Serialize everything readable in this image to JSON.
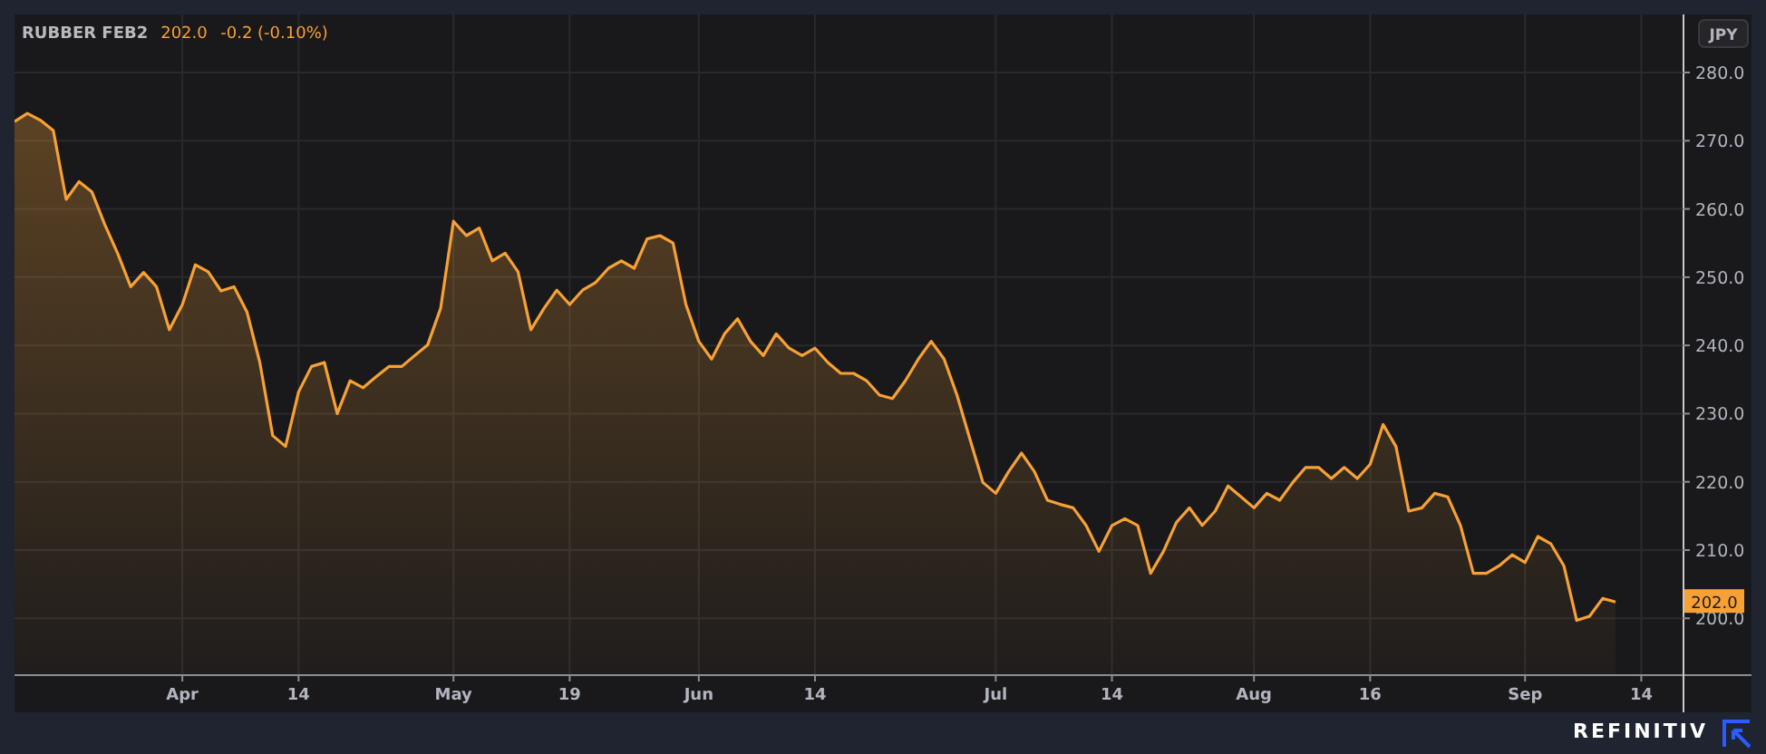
{
  "header": {
    "price": "202.0",
    "change": "-0.2 (-0.10%)"
  },
  "currency": "JPY",
  "last_price_label": "202.0",
  "chart_data": {
    "type": "area",
    "grid": true,
    "ylim": [
      191.8,
      288.5
    ],
    "categories": [
      null,
      null,
      null,
      null,
      null,
      null,
      null,
      null,
      null,
      null,
      null,
      null,
      null,
      "Apr",
      null,
      null,
      null,
      null,
      null,
      null,
      null,
      null,
      "14",
      null,
      null,
      null,
      null,
      null,
      null,
      null,
      null,
      null,
      null,
      null,
      "May",
      null,
      null,
      null,
      null,
      null,
      null,
      null,
      null,
      "19",
      null,
      null,
      null,
      null,
      null,
      null,
      null,
      null,
      null,
      "Jun",
      null,
      null,
      null,
      null,
      null,
      null,
      null,
      null,
      "14",
      null,
      null,
      null,
      null,
      null,
      null,
      null,
      null,
      null,
      null,
      null,
      null,
      null,
      "Jul",
      null,
      null,
      null,
      null,
      null,
      null,
      null,
      null,
      "14",
      null,
      null,
      null,
      null,
      null,
      null,
      null,
      null,
      null,
      null,
      "Aug",
      null,
      null,
      null,
      null,
      null,
      null,
      null,
      null,
      "16",
      null,
      null,
      null,
      null,
      null,
      null,
      null,
      null,
      null,
      null,
      null,
      "Sep",
      null,
      null,
      null,
      null,
      null,
      null,
      null,
      null,
      "14",
      null,
      null,
      null
    ],
    "series": [
      {
        "name": "RUBBER FEB2",
        "color": "#f7a135",
        "values": [
          272.8,
          274,
          273,
          271.5,
          261.4,
          264,
          262.5,
          257.7,
          253.4,
          248.6,
          250.7,
          248.6,
          242.3,
          246,
          251.8,
          250.8,
          248,
          248.6,
          244.9,
          237.5,
          226.8,
          225.2,
          233.2,
          236.9,
          237.5,
          230,
          234.8,
          233.8,
          235.4,
          236.9,
          236.9,
          238.5,
          240.1,
          245.4,
          258.2,
          256.1,
          257.2,
          252.4,
          253.5,
          250.8,
          242.3,
          245.4,
          248.1,
          246,
          248.1,
          249.2,
          251.3,
          252.4,
          251.3,
          255.6,
          256.1,
          255,
          246,
          240.6,
          238,
          241.7,
          243.9,
          240.6,
          238.5,
          241.7,
          239.6,
          238.5,
          239.6,
          237.5,
          235.9,
          235.9,
          234.8,
          232.7,
          232.2,
          234.8,
          238,
          240.6,
          238,
          232.7,
          226.3,
          219.9,
          218.3,
          221.5,
          224.2,
          221.5,
          217.3,
          216.7,
          216.2,
          213.6,
          209.8,
          213.6,
          214.6,
          213.6,
          206.6,
          209.8,
          214.1,
          216.2,
          213.6,
          215.7,
          219.4,
          217.8,
          216.2,
          218.3,
          217.3,
          219.9,
          222.1,
          222.1,
          220.5,
          222.1,
          220.5,
          222.6,
          228.4,
          225.2,
          215.7,
          216.2,
          218.3,
          217.8,
          213.6,
          206.6,
          206.6,
          207.7,
          209.3,
          208.2,
          212,
          210.9,
          207.7,
          199.7,
          200.3,
          202.9,
          202.4,
          null,
          null,
          null,
          null,
          null
        ]
      }
    ],
    "yticks": [
      {
        "value": 200,
        "label": "200.0"
      },
      {
        "value": 210,
        "label": "210.0"
      },
      {
        "value": 220,
        "label": "220.0"
      },
      {
        "value": 230,
        "label": "230.0"
      },
      {
        "value": 240,
        "label": "240.0"
      },
      {
        "value": 250,
        "label": "250.0"
      },
      {
        "value": 260,
        "label": "260.0"
      },
      {
        "value": 270,
        "label": "270.0"
      },
      {
        "value": 280,
        "label": "280.0"
      }
    ]
  },
  "brand": "REFINITIV"
}
